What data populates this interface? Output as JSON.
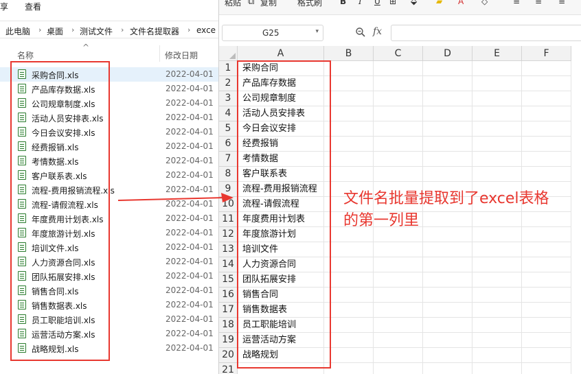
{
  "explorer": {
    "menu": [
      "享",
      "查看"
    ],
    "address": [
      "此电脑",
      "桌面",
      "测试文件",
      "文件名提取器",
      "exce"
    ],
    "columns": {
      "name": "名称",
      "date": "修改日期"
    },
    "files": [
      {
        "name": "采购合同.xls",
        "date": "2022-04-01"
      },
      {
        "name": "产品库存数据.xls",
        "date": "2022-04-01"
      },
      {
        "name": "公司规章制度.xls",
        "date": "2022-04-01"
      },
      {
        "name": "活动人员安排表.xls",
        "date": "2022-04-01"
      },
      {
        "name": "今日会议安排.xls",
        "date": "2022-04-01"
      },
      {
        "name": "经费报销.xls",
        "date": "2022-04-01"
      },
      {
        "name": "考情数据.xls",
        "date": "2022-04-01"
      },
      {
        "name": "客户联系表.xls",
        "date": "2022-04-01"
      },
      {
        "name": "流程-费用报销流程.xls",
        "date": "2022-04-01"
      },
      {
        "name": "流程-请假流程.xls",
        "date": "2022-04-01"
      },
      {
        "name": "年度费用计划表.xls",
        "date": "2022-04-01"
      },
      {
        "name": "年度旅游计划.xls",
        "date": "2022-04-01"
      },
      {
        "name": "培训文件.xls",
        "date": "2022-04-01"
      },
      {
        "name": "人力资源合同.xls",
        "date": "2022-04-01"
      },
      {
        "name": "团队拓展安排.xls",
        "date": "2022-04-01"
      },
      {
        "name": "销售合同.xls",
        "date": "2022-04-01"
      },
      {
        "name": "销售数据表.xls",
        "date": "2022-04-01"
      },
      {
        "name": "员工职能培训.xls",
        "date": "2022-04-01"
      },
      {
        "name": "运营活动方案.xls",
        "date": "2022-04-01"
      },
      {
        "name": "战略规划.xls",
        "date": "2022-04-01"
      }
    ]
  },
  "excel": {
    "ribbon": {
      "paste": "粘贴",
      "copy": "复制",
      "format_painter": "格式刷",
      "bold": "B",
      "italic": "I",
      "underline": "U"
    },
    "name_box": "G25",
    "fx": "fx",
    "columns": [
      "A",
      "B",
      "C",
      "D",
      "E",
      "F"
    ],
    "rows": [
      "1",
      "2",
      "3",
      "4",
      "5",
      "6",
      "7",
      "8",
      "9",
      "10",
      "11",
      "12",
      "13",
      "14",
      "15",
      "16",
      "17",
      "18",
      "19",
      "20",
      "21"
    ],
    "column_a": [
      "采购合同",
      "产品库存数据",
      "公司规章制度",
      "活动人员安排表",
      "今日会议安排",
      "经费报销",
      "考情数据",
      "客户联系表",
      "流程-费用报销流程",
      "流程-请假流程",
      "年度费用计划表",
      "年度旅游计划",
      "培训文件",
      "人力资源合同",
      "团队拓展安排",
      "销售合同",
      "销售数据表",
      "员工职能培训",
      "运营活动方案",
      "战略规划"
    ]
  },
  "annotation": {
    "text_line1": "文件名批量提取到了excel表格",
    "text_line2": "的第一列里",
    "color": "#e8372f"
  }
}
